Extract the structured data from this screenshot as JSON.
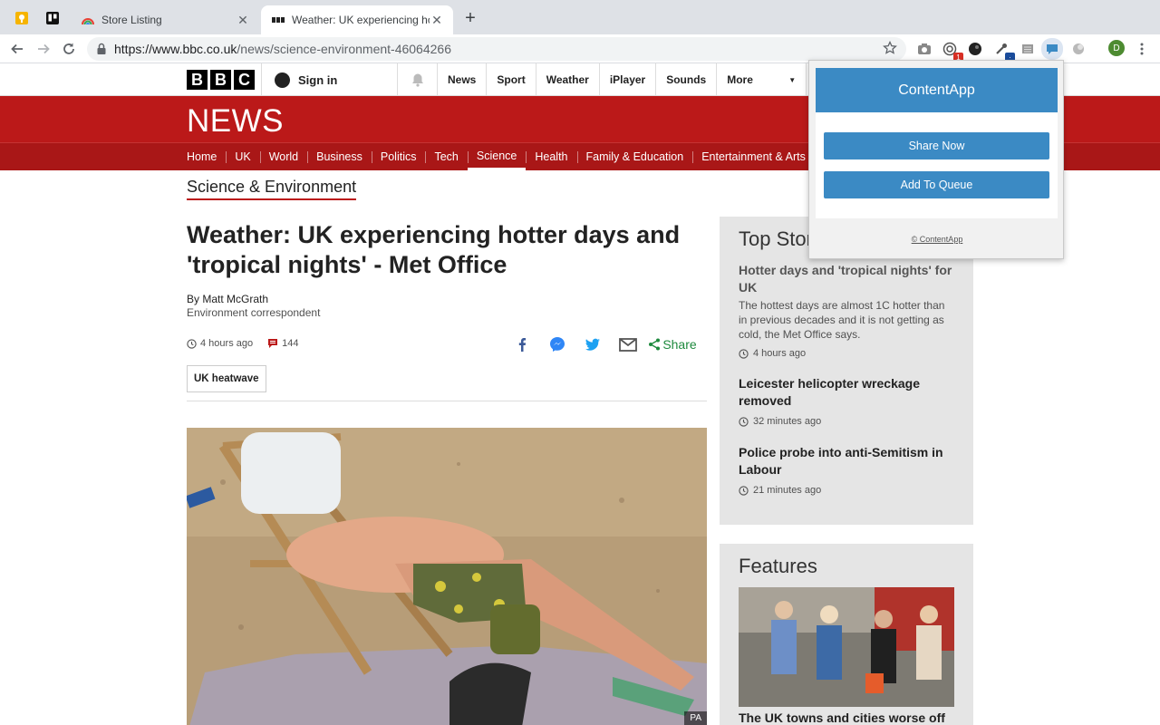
{
  "browser": {
    "tabs": [
      {
        "title": "Store Listing",
        "active": false
      },
      {
        "title": "Weather: UK experiencing hotter days and 'tropical nights' - Met Office",
        "active": true
      }
    ],
    "url_host": "https://www.bbc.co.uk",
    "url_path": "/news/science-environment-46064266",
    "extension_badges": {
      "red": "1",
      "blue": "·"
    },
    "profile_initial": "D"
  },
  "bbc": {
    "logo_letters": [
      "B",
      "B",
      "C"
    ],
    "sign_in": "Sign in",
    "top_nav": [
      "News",
      "Sport",
      "Weather",
      "iPlayer",
      "Sounds",
      "More"
    ],
    "news_logo": "NEWS",
    "section_nav": [
      "Home",
      "UK",
      "World",
      "Business",
      "Politics",
      "Tech",
      "Science",
      "Health",
      "Family & Education",
      "Entertainment & Arts"
    ],
    "current_section": "Science"
  },
  "article": {
    "section_title": "Science & Environment",
    "headline": "Weather: UK experiencing hotter days and 'tropical nights' - Met Office",
    "author": "By Matt McGrath",
    "role": "Environment correspondent",
    "time": "4 hours ago",
    "comments": "144",
    "share_label": "Share",
    "tag": "UK heatwave",
    "photo_credit": "PA"
  },
  "top_stories": {
    "heading": "Top Stories",
    "items": [
      {
        "headline": "Hotter days and 'tropical nights' for UK",
        "summary": "The hottest days are almost 1C hotter than in previous decades and it is not getting as cold, the Met Office says.",
        "time": "4 hours ago"
      },
      {
        "headline": "Leicester helicopter wreckage removed",
        "time": "32 minutes ago"
      },
      {
        "headline": "Police probe into anti-Semitism in Labour",
        "time": "21 minutes ago"
      }
    ]
  },
  "features": {
    "heading": "Features",
    "first_title": "The UK towns and cities worse off"
  },
  "popup": {
    "title": "ContentApp",
    "share_now": "Share Now",
    "add_to_queue": "Add To Queue",
    "footer": "© ContentApp"
  },
  "colors": {
    "bbc_red": "#bb1919",
    "popup_blue": "#3b8ac4",
    "share_green": "#1e8a3e"
  }
}
